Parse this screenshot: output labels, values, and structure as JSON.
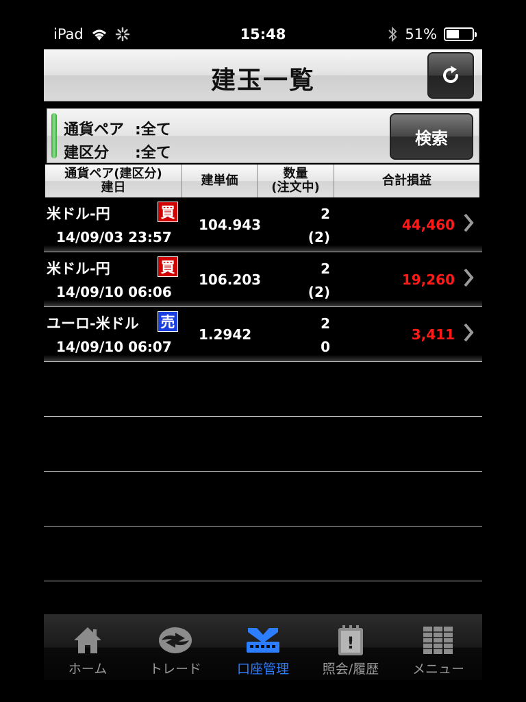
{
  "status_bar": {
    "device": "iPad",
    "time": "15:48",
    "battery": "51%",
    "battery_level": 0.51
  },
  "header": {
    "title": "建玉一覧"
  },
  "filter": {
    "pair_label": "通貨ペア",
    "pair_value": ":全て",
    "side_label": "建区分",
    "side_value": ":全て",
    "search_label": "検索"
  },
  "columns": {
    "pair_line1": "通貨ペア(建区分)",
    "pair_line2": "建日",
    "price": "建単価",
    "qty_line1": "数量",
    "qty_line2": "(注文中)",
    "pnl": "合計損益"
  },
  "positions": [
    {
      "pair": "米ドル-円",
      "side": "買",
      "side_type": "buy",
      "date": "14/09/03 23:57",
      "price": "104.943",
      "qty": "2",
      "pending": "(2)",
      "pnl": "44,460"
    },
    {
      "pair": "米ドル-円",
      "side": "買",
      "side_type": "buy",
      "date": "14/09/10 06:06",
      "price": "106.203",
      "qty": "2",
      "pending": "(2)",
      "pnl": "19,260"
    },
    {
      "pair": "ユーロ-米ドル",
      "side": "売",
      "side_type": "sell",
      "date": "14/09/10 06:07",
      "price": "1.2942",
      "qty": "2",
      "pending": "0",
      "pnl": "3,411"
    }
  ],
  "colors": {
    "buy": "#d10000",
    "sell": "#1a3fe0",
    "pnl": "#ff1a1a",
    "active_tab": "#2d7dff"
  },
  "tabs": [
    {
      "label": "ホーム",
      "icon": "home-icon"
    },
    {
      "label": "トレード",
      "icon": "trade-icon"
    },
    {
      "label": "口座管理",
      "icon": "account-icon",
      "active": true
    },
    {
      "label": "照会/履歴",
      "icon": "history-icon"
    },
    {
      "label": "メニュー",
      "icon": "menu-icon"
    }
  ]
}
